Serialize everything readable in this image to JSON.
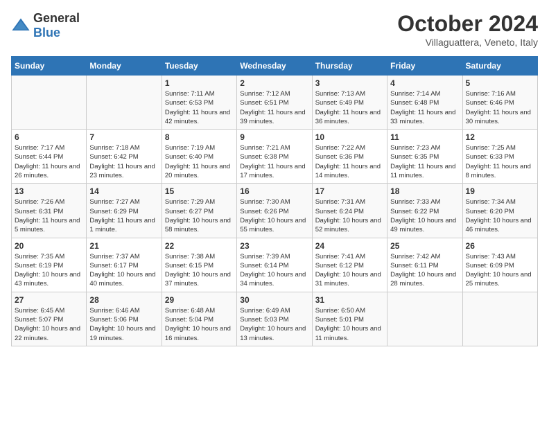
{
  "header": {
    "logo_general": "General",
    "logo_blue": "Blue",
    "title": "October 2024",
    "subtitle": "Villaguattera, Veneto, Italy"
  },
  "days_of_week": [
    "Sunday",
    "Monday",
    "Tuesday",
    "Wednesday",
    "Thursday",
    "Friday",
    "Saturday"
  ],
  "weeks": [
    [
      {
        "day": "",
        "details": ""
      },
      {
        "day": "",
        "details": ""
      },
      {
        "day": "1",
        "details": "Sunrise: 7:11 AM\nSunset: 6:53 PM\nDaylight: 11 hours and 42 minutes."
      },
      {
        "day": "2",
        "details": "Sunrise: 7:12 AM\nSunset: 6:51 PM\nDaylight: 11 hours and 39 minutes."
      },
      {
        "day": "3",
        "details": "Sunrise: 7:13 AM\nSunset: 6:49 PM\nDaylight: 11 hours and 36 minutes."
      },
      {
        "day": "4",
        "details": "Sunrise: 7:14 AM\nSunset: 6:48 PM\nDaylight: 11 hours and 33 minutes."
      },
      {
        "day": "5",
        "details": "Sunrise: 7:16 AM\nSunset: 6:46 PM\nDaylight: 11 hours and 30 minutes."
      }
    ],
    [
      {
        "day": "6",
        "details": "Sunrise: 7:17 AM\nSunset: 6:44 PM\nDaylight: 11 hours and 26 minutes."
      },
      {
        "day": "7",
        "details": "Sunrise: 7:18 AM\nSunset: 6:42 PM\nDaylight: 11 hours and 23 minutes."
      },
      {
        "day": "8",
        "details": "Sunrise: 7:19 AM\nSunset: 6:40 PM\nDaylight: 11 hours and 20 minutes."
      },
      {
        "day": "9",
        "details": "Sunrise: 7:21 AM\nSunset: 6:38 PM\nDaylight: 11 hours and 17 minutes."
      },
      {
        "day": "10",
        "details": "Sunrise: 7:22 AM\nSunset: 6:36 PM\nDaylight: 11 hours and 14 minutes."
      },
      {
        "day": "11",
        "details": "Sunrise: 7:23 AM\nSunset: 6:35 PM\nDaylight: 11 hours and 11 minutes."
      },
      {
        "day": "12",
        "details": "Sunrise: 7:25 AM\nSunset: 6:33 PM\nDaylight: 11 hours and 8 minutes."
      }
    ],
    [
      {
        "day": "13",
        "details": "Sunrise: 7:26 AM\nSunset: 6:31 PM\nDaylight: 11 hours and 5 minutes."
      },
      {
        "day": "14",
        "details": "Sunrise: 7:27 AM\nSunset: 6:29 PM\nDaylight: 11 hours and 1 minute."
      },
      {
        "day": "15",
        "details": "Sunrise: 7:29 AM\nSunset: 6:27 PM\nDaylight: 10 hours and 58 minutes."
      },
      {
        "day": "16",
        "details": "Sunrise: 7:30 AM\nSunset: 6:26 PM\nDaylight: 10 hours and 55 minutes."
      },
      {
        "day": "17",
        "details": "Sunrise: 7:31 AM\nSunset: 6:24 PM\nDaylight: 10 hours and 52 minutes."
      },
      {
        "day": "18",
        "details": "Sunrise: 7:33 AM\nSunset: 6:22 PM\nDaylight: 10 hours and 49 minutes."
      },
      {
        "day": "19",
        "details": "Sunrise: 7:34 AM\nSunset: 6:20 PM\nDaylight: 10 hours and 46 minutes."
      }
    ],
    [
      {
        "day": "20",
        "details": "Sunrise: 7:35 AM\nSunset: 6:19 PM\nDaylight: 10 hours and 43 minutes."
      },
      {
        "day": "21",
        "details": "Sunrise: 7:37 AM\nSunset: 6:17 PM\nDaylight: 10 hours and 40 minutes."
      },
      {
        "day": "22",
        "details": "Sunrise: 7:38 AM\nSunset: 6:15 PM\nDaylight: 10 hours and 37 minutes."
      },
      {
        "day": "23",
        "details": "Sunrise: 7:39 AM\nSunset: 6:14 PM\nDaylight: 10 hours and 34 minutes."
      },
      {
        "day": "24",
        "details": "Sunrise: 7:41 AM\nSunset: 6:12 PM\nDaylight: 10 hours and 31 minutes."
      },
      {
        "day": "25",
        "details": "Sunrise: 7:42 AM\nSunset: 6:11 PM\nDaylight: 10 hours and 28 minutes."
      },
      {
        "day": "26",
        "details": "Sunrise: 7:43 AM\nSunset: 6:09 PM\nDaylight: 10 hours and 25 minutes."
      }
    ],
    [
      {
        "day": "27",
        "details": "Sunrise: 6:45 AM\nSunset: 5:07 PM\nDaylight: 10 hours and 22 minutes."
      },
      {
        "day": "28",
        "details": "Sunrise: 6:46 AM\nSunset: 5:06 PM\nDaylight: 10 hours and 19 minutes."
      },
      {
        "day": "29",
        "details": "Sunrise: 6:48 AM\nSunset: 5:04 PM\nDaylight: 10 hours and 16 minutes."
      },
      {
        "day": "30",
        "details": "Sunrise: 6:49 AM\nSunset: 5:03 PM\nDaylight: 10 hours and 13 minutes."
      },
      {
        "day": "31",
        "details": "Sunrise: 6:50 AM\nSunset: 5:01 PM\nDaylight: 10 hours and 11 minutes."
      },
      {
        "day": "",
        "details": ""
      },
      {
        "day": "",
        "details": ""
      }
    ]
  ]
}
